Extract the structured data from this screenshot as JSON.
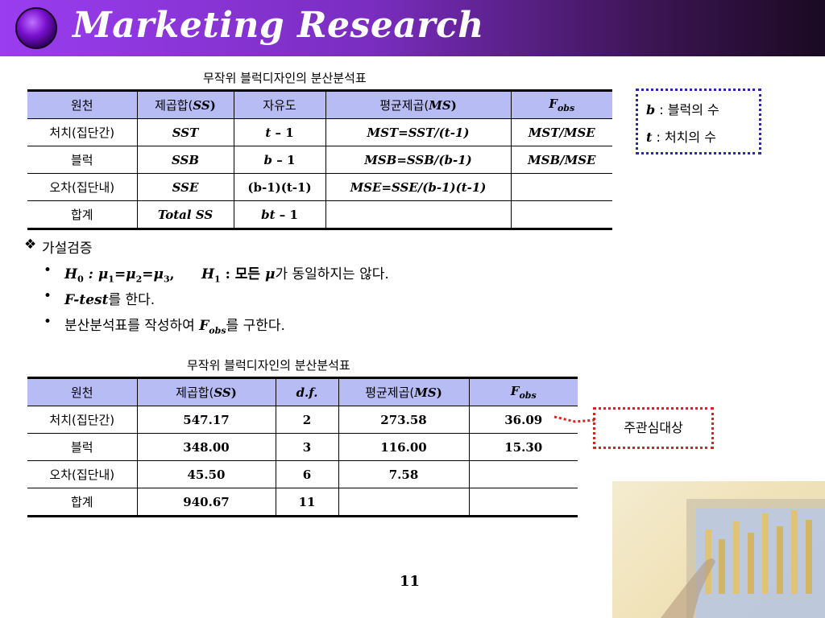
{
  "header": {
    "title": "Marketing Research"
  },
  "table1": {
    "caption": "무작위 블럭디자인의 분산분석표",
    "headers": [
      "원천",
      "제곱합(",
      "SS",
      ")",
      "자유도",
      "평균제곱(",
      "MS",
      ")",
      "F",
      "obs"
    ],
    "rows": [
      [
        "처치(집단간)",
        "SST",
        "t",
        "– 1",
        "MST=SST/(t-1)",
        "MST/MSE"
      ],
      [
        "블럭",
        "SSB",
        "b",
        "– 1",
        "MSB=SSB/(b-1)",
        "MSB/MSE"
      ],
      [
        "오차(집단내)",
        "SSE",
        "(b-1)(t-1)",
        "",
        "MSE=SSE/(b-1)(t-1)",
        ""
      ],
      [
        "합계",
        "Total SS",
        "bt",
        "– 1",
        "",
        ""
      ]
    ]
  },
  "note": {
    "b_sym": "b",
    "b_text": " : 블럭의 수",
    "t_sym": "t",
    "t_text": " : 처치의 수"
  },
  "bullets": {
    "heading_mark": "❖",
    "heading": "가설검증",
    "dot": "•",
    "b1": {
      "h0": "H",
      "h0_sub": "0",
      "h0_expr_a": " : μ",
      "s1": "1",
      "eq1": "=μ",
      "s2": "2",
      "eq2": "=μ",
      "s3": "3",
      "comma": ",",
      "h1": "H",
      "h1_sub": "1",
      "h1_text_a": " : 모든 ",
      "mu": "μ",
      "h1_text_b": "가 동일하지는 않다."
    },
    "b2": {
      "ftest": "F-test",
      "rest": "를 한다."
    },
    "b3": {
      "pre": "분산분석표를 작성하여 ",
      "f": "F",
      "f_sub": "obs",
      "post": "를 구한다."
    }
  },
  "table2": {
    "caption": "무작위 블럭디자인의 분산분석표",
    "headers": [
      "원천",
      "제곱합(",
      "SS",
      ")",
      "d.f.",
      "평균제곱(",
      "MS",
      ")",
      "F",
      "obs"
    ],
    "rows": [
      [
        "처치(집단간)",
        "547.17",
        "2",
        "273.58",
        "36.09"
      ],
      [
        "블럭",
        "348.00",
        "3",
        "116.00",
        "15.30"
      ],
      [
        "오차(집단내)",
        "45.50",
        "6",
        "7.58",
        ""
      ],
      [
        "합계",
        "940.67",
        "11",
        "",
        ""
      ]
    ]
  },
  "focus": {
    "label": "주관심대상"
  },
  "page": {
    "number": "11"
  },
  "colors": {
    "header_accent": "#9a3df0",
    "table_header": "#b8bcf4",
    "note_border": "#2a2aa8",
    "focus_border": "#e02020"
  }
}
